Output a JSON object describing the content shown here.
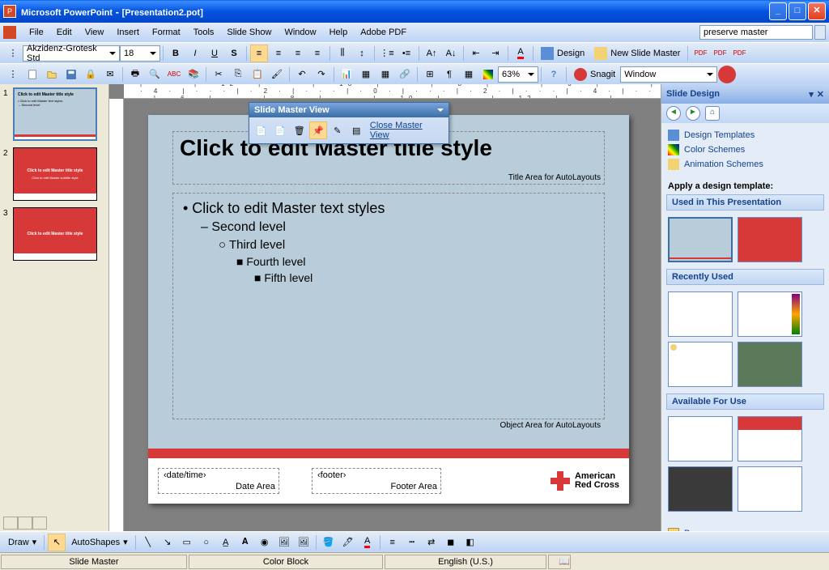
{
  "titlebar": {
    "app": "Microsoft PowerPoint",
    "doc": "[Presentation2.pot]"
  },
  "menus": [
    "File",
    "Edit",
    "View",
    "Insert",
    "Format",
    "Tools",
    "Slide Show",
    "Window",
    "Help",
    "Adobe PDF"
  ],
  "help_search": {
    "value": "preserve master"
  },
  "formatting": {
    "font": "Akzidenz-Grotesk Std",
    "size": "18"
  },
  "design_btn": "Design",
  "new_master_btn": "New Slide Master",
  "zoom": "63%",
  "snagit_label": "Snagit",
  "window_combo": "Window",
  "ruler": "| · · · | · 12 · | · · · | · 10 · | · · · | · 8 · | · · · | · 6 · | · · · | · 4 · | · · · | · 2 · | · · · | · 0 · | · · · | · 2 · | · · · | · 4 · | · · · | · 6 · | · · · | · 8 · | · · · | · 10 · | · · · | · 12 · | · · · |",
  "master": {
    "title": "Click to edit Master title style",
    "title_sub": "Title Area for AutoLayouts",
    "l1": "• Click to edit Master text styles",
    "l2": "– Second level",
    "l3": "○ Third level",
    "l4": "■ Fourth level",
    "l5": "■ Fifth level",
    "obj_label": "Object Area for AutoLayouts",
    "date_ph": "‹date/time›",
    "date_lbl": "Date Area",
    "footer_ph": "‹footer›",
    "footer_lbl": "Footer Area",
    "logo_line1": "American",
    "logo_line2": "Red Cross"
  },
  "thumbs": {
    "t1": "Click to edit Master title style",
    "t2": "Click to edit Master title style",
    "t3": "Click to edit Master title style"
  },
  "smv": {
    "title": "Slide Master View",
    "close": "Close Master View"
  },
  "taskpane": {
    "title": "Slide Design",
    "links": [
      "Design Templates",
      "Color Schemes",
      "Animation Schemes"
    ],
    "apply_label": "Apply a design template:",
    "sec1": "Used in This Presentation",
    "sec2": "Recently Used",
    "sec3": "Available For Use",
    "browse": "Browse..."
  },
  "draw": {
    "menu": "Draw",
    "autoshapes": "AutoShapes"
  },
  "status": {
    "left": "Slide Master",
    "mid": "Color Block",
    "lang": "English (U.S.)"
  }
}
